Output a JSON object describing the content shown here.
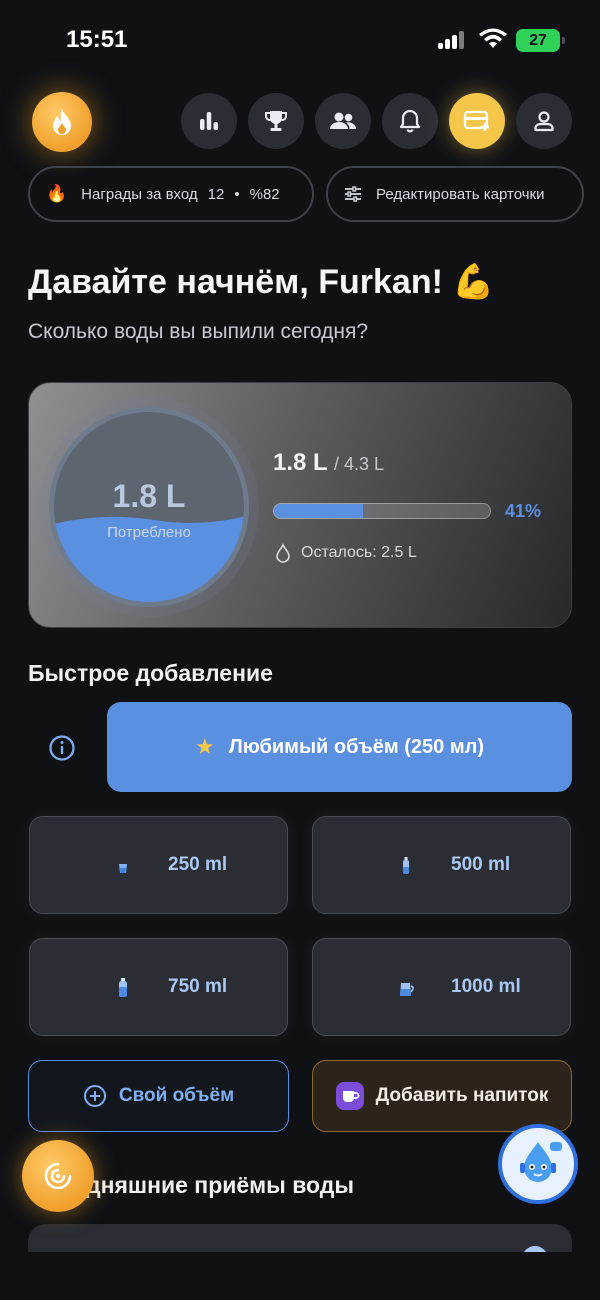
{
  "status_bar": {
    "time": "15:51",
    "battery": "27"
  },
  "header": {
    "rewards_pill": {
      "label": "Награды за вход",
      "streak": "12",
      "separator": "•",
      "percent": "%82"
    },
    "edit_pill": {
      "label": "Редактировать карточки"
    }
  },
  "greeting": {
    "title": "Давайте начнём, Furkan! 💪",
    "subtitle": "Сколько воды вы выпили сегодня?"
  },
  "water_card": {
    "consumed": "1.8 L",
    "consumed_caption": "Потреблено",
    "amount": "1.8 L",
    "goal": "/ 4.3 L",
    "progress_percent_label": "41%",
    "progress": 0.41,
    "remaining": "Осталось: 2.5 L"
  },
  "quick_add": {
    "title": "Быстрое добавление",
    "favorite": "Любимый объём (250 мл)",
    "volumes": [
      {
        "label": "250 ml",
        "icon": "glass-icon"
      },
      {
        "label": "500 ml",
        "icon": "bottle-icon"
      },
      {
        "label": "750 ml",
        "icon": "large-bottle-icon"
      },
      {
        "label": "1000 ml",
        "icon": "jug-icon"
      }
    ],
    "custom": "Свой объём",
    "drink": "Добавить напиток"
  },
  "today": {
    "title": "дняшние приёмы воды"
  },
  "colors": {
    "accent_blue": "#5b8fe0",
    "accent_gold": "#f4c64a",
    "background": "#0f1115"
  }
}
